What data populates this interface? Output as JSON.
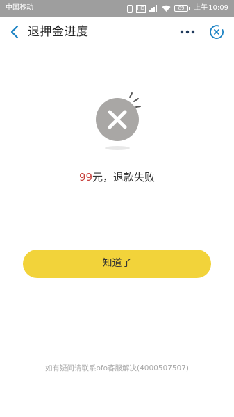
{
  "status_bar": {
    "carrier": "中国移动",
    "hd_badge": "HD",
    "network_type": "4G",
    "battery_level": "89",
    "time_prefix": "上午",
    "time": "10:09"
  },
  "header": {
    "title": "退押金进度",
    "back_icon": "chevron-left-icon",
    "more_icon": "more-dots-icon",
    "close_icon": "circle-close-icon",
    "accent_color": "#1a82c4"
  },
  "result": {
    "icon": "fail-x-icon",
    "amount": "99",
    "message_rest": "元，退款失败",
    "amount_color": "#c8413c"
  },
  "actions": {
    "ok_label": "知道了",
    "ok_color": "#f2d33a"
  },
  "footer": {
    "help_text": "如有疑问请联系ofo客服解决(4000507507)"
  }
}
